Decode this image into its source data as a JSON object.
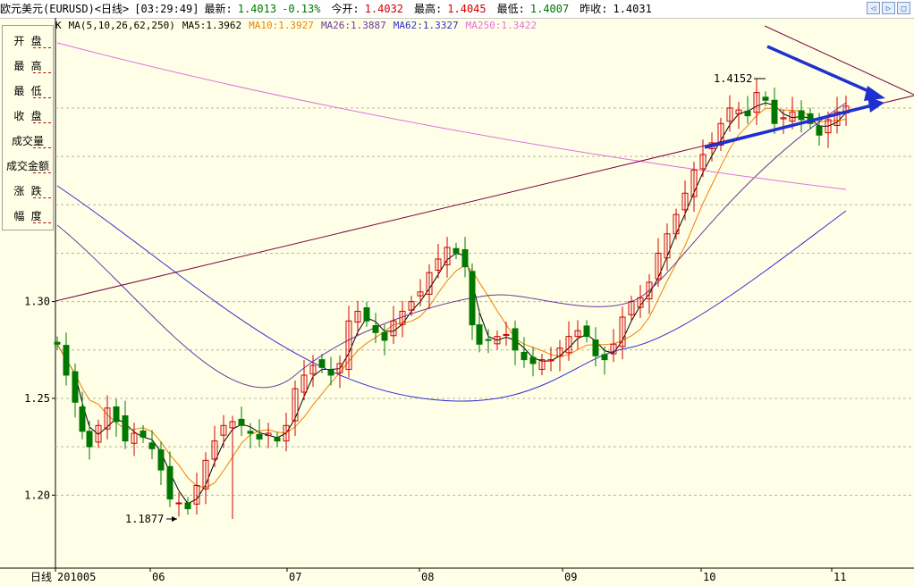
{
  "titlebar": {
    "name": "欧元美元(EURUSD)<日线>",
    "time": "[03:29:49]",
    "latest_label": "最新:",
    "latest_value": "1.4013",
    "change": "-0.13%",
    "open_label": "今开:",
    "open_value": "1.4032",
    "high_label": "最高:",
    "high_value": "1.4045",
    "low_label": "最低:",
    "low_value": "1.4007",
    "prev_close_label": "昨收:",
    "prev_close_value": "1.4031"
  },
  "ma_legend": {
    "k_label": "K",
    "params": "MA(5,10,26,62,250)",
    "ma5": "MA5:1.3962",
    "ma10": "MA10:1.3927",
    "ma26": "MA26:1.3887",
    "ma62": "MA62:1.3327",
    "ma250": "MA250:1.3422"
  },
  "side_panel": {
    "items": [
      {
        "label": "开  盘"
      },
      {
        "label": "最  高"
      },
      {
        "label": "最  低"
      },
      {
        "label": "收  盘"
      },
      {
        "label": "成交量"
      },
      {
        "label": "成交金额"
      },
      {
        "label": "涨  跌"
      },
      {
        "label": "幅  度"
      }
    ]
  },
  "window_buttons": [
    "◁",
    "▷",
    "□"
  ],
  "colors": {
    "background": "#ffffe8",
    "up": "#d00000",
    "down": "#007800",
    "ma5": "#000000",
    "ma10": "#f08000",
    "ma26": "#6a3a9a",
    "ma62": "#3030d0",
    "ma250": "#e070e0",
    "trendline": "#800040",
    "annotation": "#2030d0"
  },
  "chart_data": {
    "type": "candlestick",
    "period_label": "日线",
    "x_labels": [
      "201005",
      "06",
      "07",
      "08",
      "09",
      "10",
      "11"
    ],
    "y_ticks": [
      1.2,
      1.25,
      1.3
    ],
    "y_tick_labels": [
      "1.20",
      "1.25",
      "1.30"
    ],
    "ylim": [
      1.172,
      1.4355
    ],
    "annotations": [
      {
        "text": "1.4152",
        "value": 1.4152
      },
      {
        "text": "1.1877",
        "value": 1.1877
      }
    ],
    "series": [
      {
        "name": "MA5",
        "value": "1.3962"
      },
      {
        "name": "MA10",
        "value": "1.3927"
      },
      {
        "name": "MA26",
        "value": "1.3887"
      },
      {
        "name": "MA62",
        "value": "1.3327"
      },
      {
        "name": "MA250",
        "value": "1.3422"
      }
    ]
  }
}
